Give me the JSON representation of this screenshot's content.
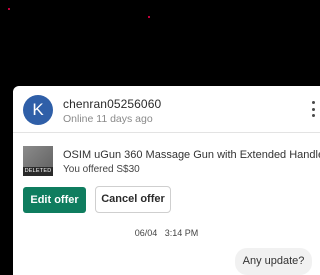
{
  "chat": {
    "username": "chenran05256060",
    "avatar_letter": "K",
    "status": "Online 11 days ago",
    "menu_icon": "more-vertical-icon"
  },
  "listing": {
    "badge": "DELETED",
    "title": "OSIM uGun 360 Massage Gun with Extended Handle",
    "offer_text": "You offered S$30",
    "edit_label": "Edit offer",
    "cancel_label": "Cancel offer"
  },
  "conversation": {
    "timestamp": "06/04   3:14 PM",
    "messages": [
      {
        "text": "Any update?"
      }
    ]
  },
  "colors": {
    "accent": "#0f7d5f",
    "avatar": "#2f5fa8"
  }
}
